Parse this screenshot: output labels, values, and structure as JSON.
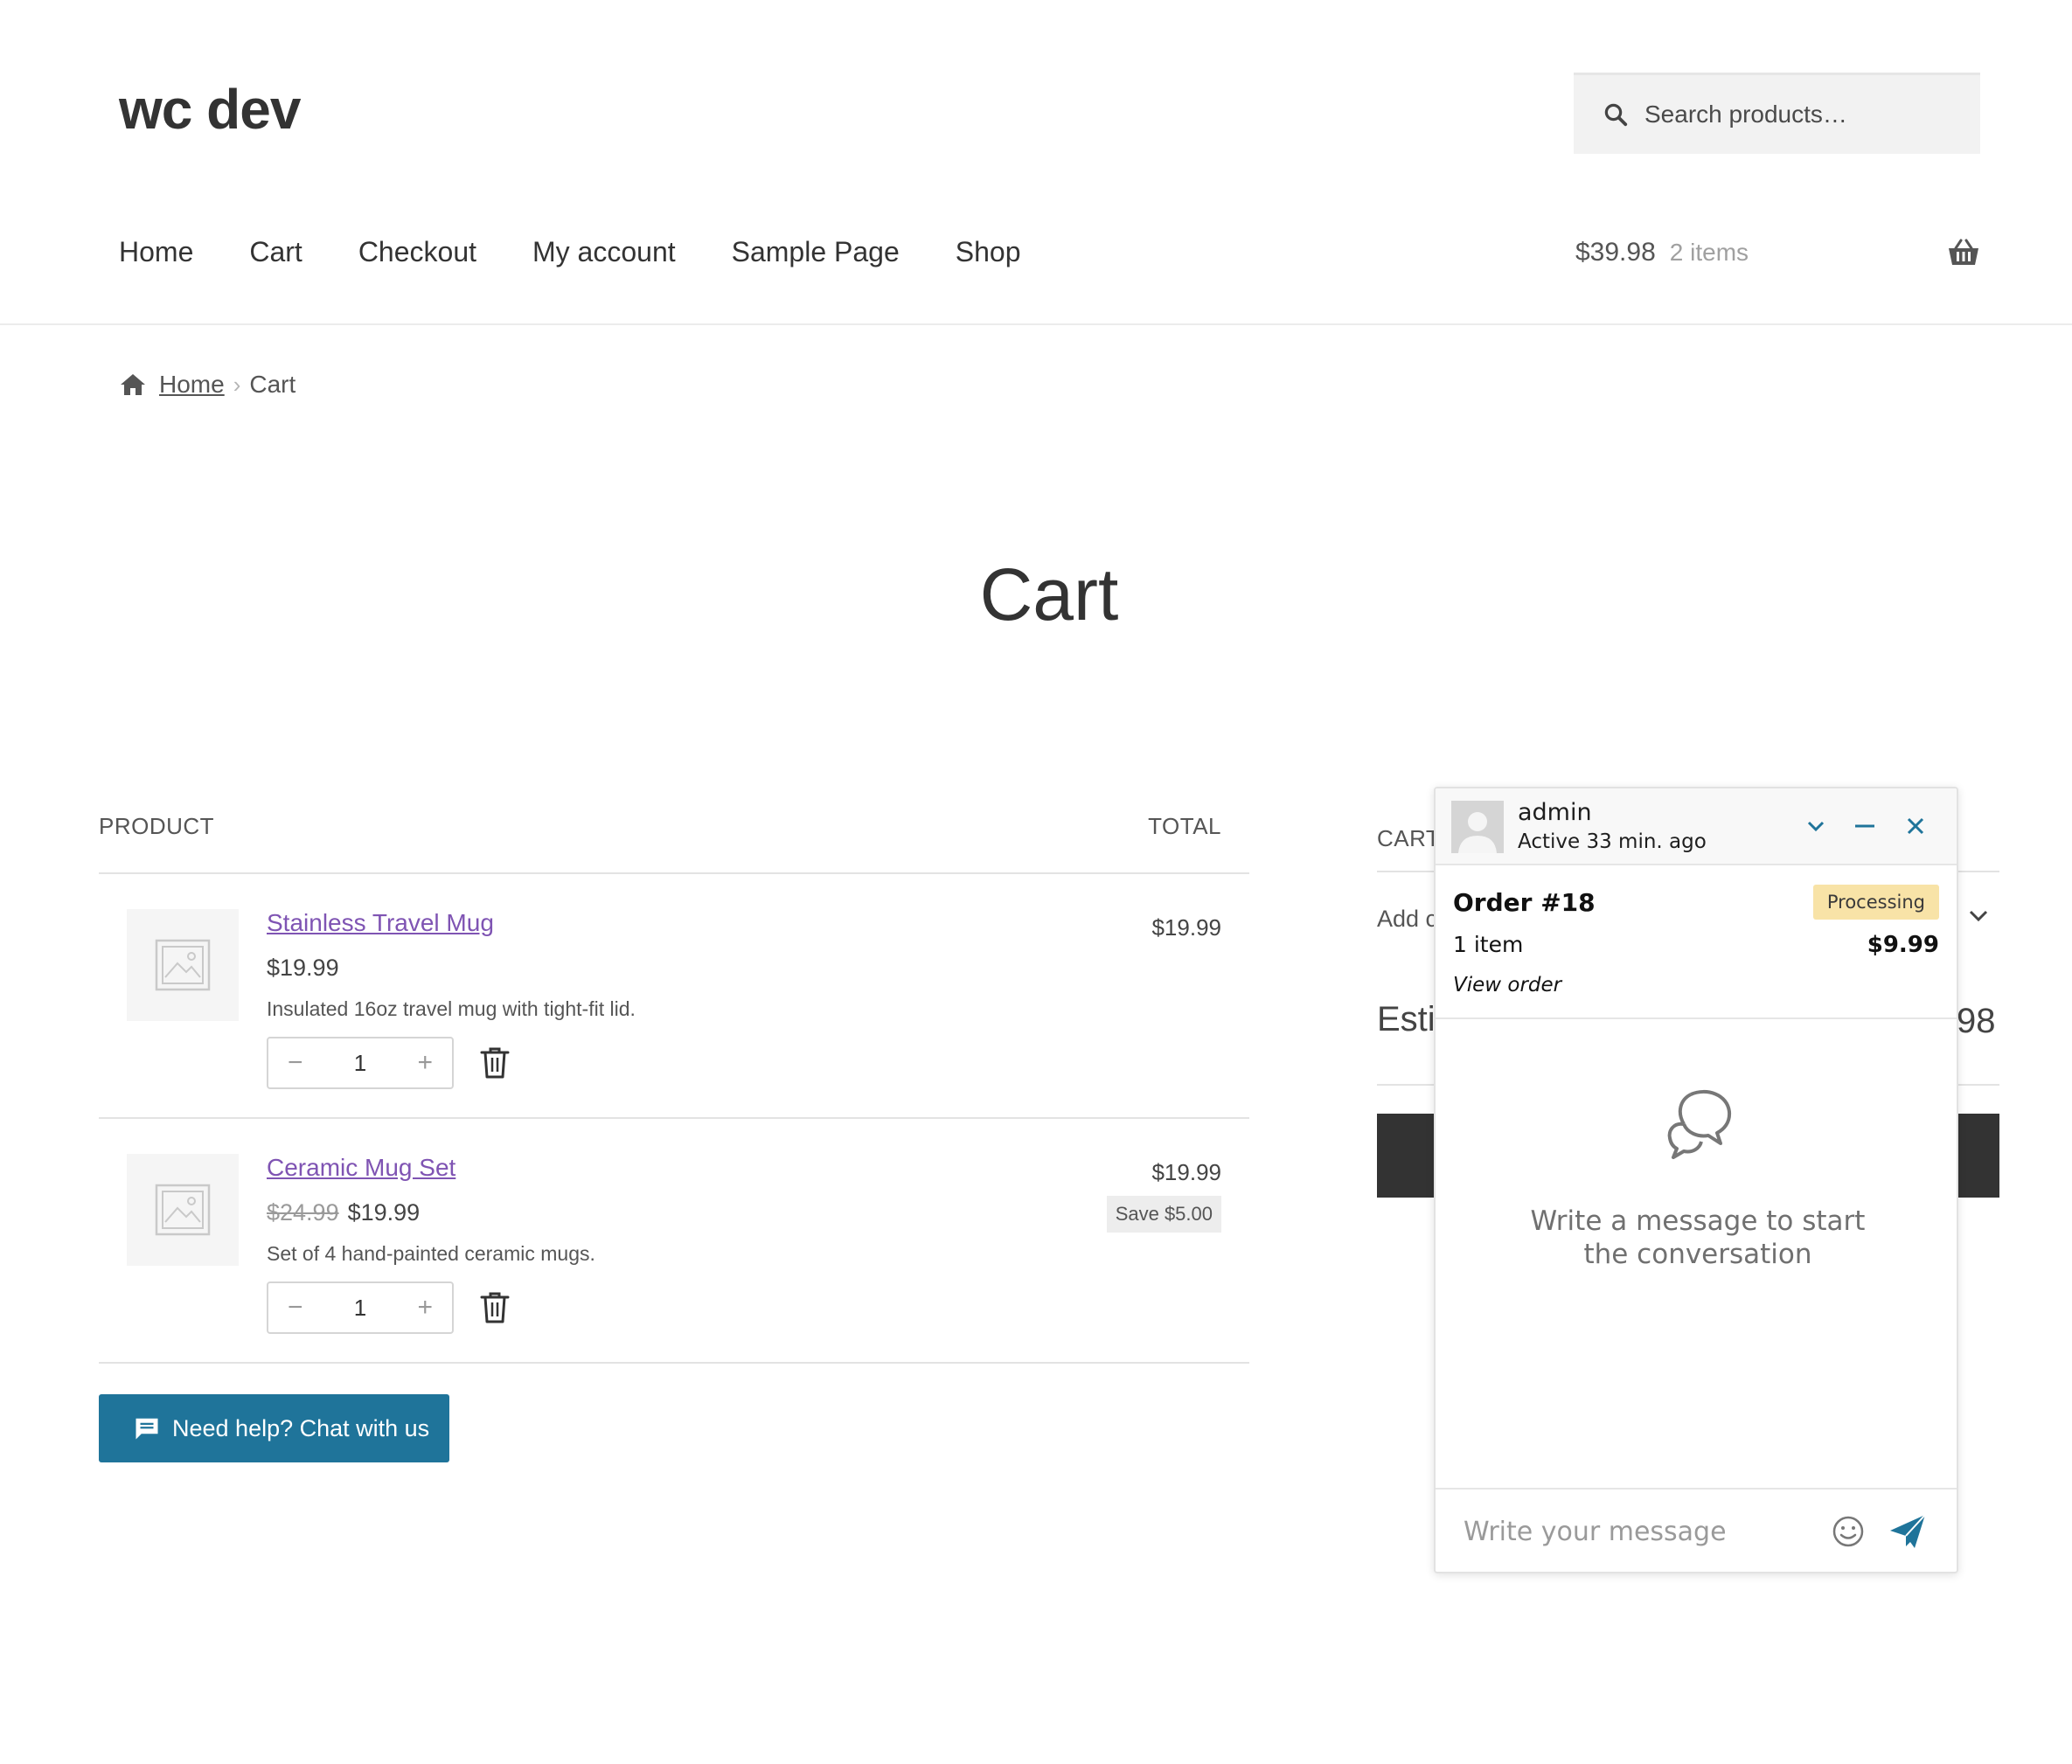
{
  "site": {
    "title": "wc dev"
  },
  "search": {
    "placeholder": "Search products…"
  },
  "nav": {
    "items": [
      "Home",
      "Cart",
      "Checkout",
      "My account",
      "Sample Page",
      "Shop"
    ]
  },
  "mini_cart": {
    "amount": "$39.98",
    "count": "2 items"
  },
  "breadcrumb": {
    "home": "Home",
    "current": "Cart"
  },
  "page": {
    "title": "Cart"
  },
  "cart_table": {
    "col_product": "PRODUCT",
    "col_total": "TOTAL",
    "rows": [
      {
        "name": "Stainless Travel Mug",
        "regular_price": "",
        "price": "$19.99",
        "description": "Insulated 16oz travel mug with tight-fit lid.",
        "qty": "1",
        "total": "$19.99",
        "save": ""
      },
      {
        "name": "Ceramic Mug Set",
        "regular_price": "$24.99",
        "price": "$19.99",
        "description": "Set of 4 hand-painted ceramic mugs.",
        "qty": "1",
        "total": "$19.99",
        "save": "Save $5.00"
      }
    ],
    "qty_minus": "−",
    "qty_plus": "+"
  },
  "help_button": {
    "label": "Need help? Chat with us"
  },
  "cart_totals": {
    "heading_partial": "CART",
    "coupon_partial": "Add c",
    "estimated_partial": "Esti",
    "total_partial": "98"
  },
  "chat": {
    "agent_name": "admin",
    "agent_status": "Active 33 min. ago",
    "order": {
      "title": "Order #18",
      "status": "Processing",
      "items": "1 item",
      "amount": "$9.99",
      "link": "View order"
    },
    "empty_message": "Write a message to start the conversation",
    "input_placeholder": "Write your message"
  },
  "colors": {
    "link_purple": "#7f54b3",
    "help_button": "#1f749a",
    "chat_accent": "#1f749a",
    "badge_processing": "#f8e3a7"
  },
  "icons": [
    "search-icon",
    "basket-icon",
    "home-icon",
    "image-placeholder-icon",
    "trash-icon",
    "chat-bubble-icon",
    "chevron-down-icon",
    "minimize-icon",
    "close-icon",
    "conversation-icon",
    "emoji-icon",
    "send-icon"
  ]
}
